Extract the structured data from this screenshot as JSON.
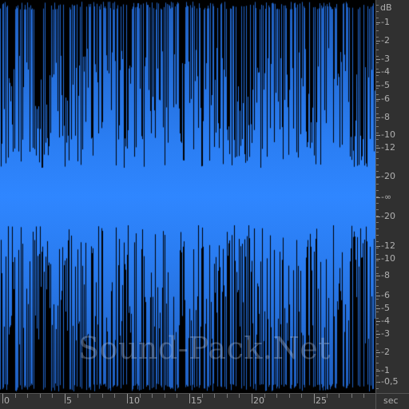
{
  "waveform": {
    "color": "#2f86ff",
    "background": "#000000"
  },
  "db_ruler": {
    "unit": "dB",
    "labels": [
      "-1",
      "-2",
      "-3",
      "-4",
      "-5",
      "-6",
      "-8",
      "-10",
      "-12",
      "-20",
      "-∞",
      "-20",
      "-12",
      "-10",
      "-8",
      "-6",
      "-5",
      "-4",
      "-3",
      "-2",
      "-1",
      "-0,5"
    ]
  },
  "time_ruler": {
    "unit": "sec",
    "labels": [
      "0",
      "5",
      "10",
      "15",
      "20",
      "25"
    ]
  },
  "watermark": "Sound-Pack.Net"
}
